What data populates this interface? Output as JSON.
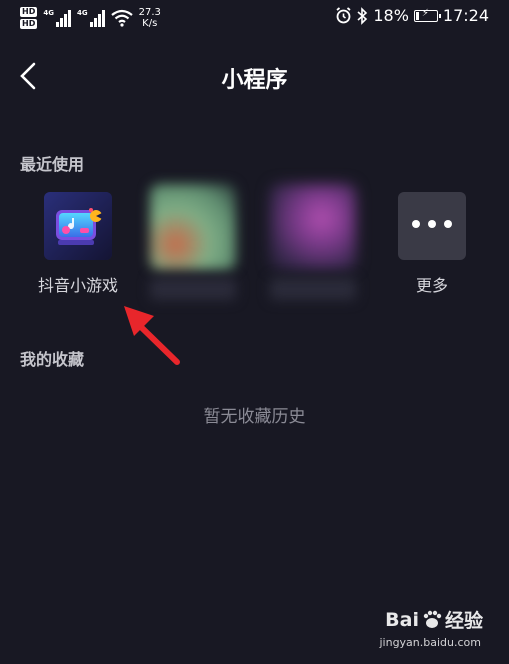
{
  "status_bar": {
    "hd1": "HD",
    "hd2": "HD",
    "net1": "4G",
    "net2": "4G",
    "speed_value": "27.3",
    "speed_unit": "K/s",
    "battery_percent": "18%",
    "battery_level": 0.18,
    "time": "17:24"
  },
  "header": {
    "title": "小程序"
  },
  "recent": {
    "title": "最近使用",
    "items": [
      {
        "label": "抖音小游戏",
        "icon": "game-controller-icon"
      },
      {
        "label": "",
        "icon": "blurred-app-icon"
      },
      {
        "label": "",
        "icon": "blurred-app-icon"
      },
      {
        "label": "更多",
        "icon": "more-dots-icon"
      }
    ]
  },
  "favorites": {
    "title": "我的收藏",
    "empty_text": "暂无收藏历史"
  },
  "watermark": {
    "brand": "Bai",
    "brand_suffix": "经验",
    "url": "jingyan.baidu.com"
  },
  "colors": {
    "background": "#181823",
    "arrow": "#e8262b",
    "more_tile": "#3a3a46"
  }
}
